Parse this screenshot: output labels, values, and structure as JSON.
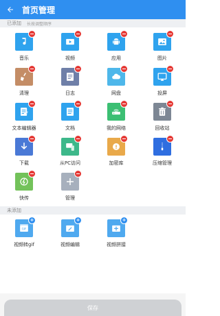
{
  "app_bar": {
    "title": "首页管理"
  },
  "added_section": {
    "label": "已添加",
    "hint": "长按调整顺序"
  },
  "added_tiles": [
    {
      "label": "音乐",
      "color": "#2fa3ee",
      "icon": "music-icon"
    },
    {
      "label": "视频",
      "color": "#2fa3ee",
      "icon": "video-icon"
    },
    {
      "label": "应用",
      "color": "#2fa3ee",
      "icon": "android-icon"
    },
    {
      "label": "图片",
      "color": "#2fa3ee",
      "icon": "image-icon"
    },
    {
      "label": "清理",
      "color": "#c48d66",
      "icon": "broom-icon"
    },
    {
      "label": "日志",
      "color": "#6f7fa8",
      "icon": "log-icon"
    },
    {
      "label": "网盘",
      "color": "#4eb7ea",
      "icon": "cloud-icon"
    },
    {
      "label": "投屏",
      "color": "#2fa3ee",
      "icon": "cast-icon"
    },
    {
      "label": "文本编辑器",
      "color": "#2fa3ee",
      "icon": "text-editor-icon"
    },
    {
      "label": "文档",
      "color": "#2fa3ee",
      "icon": "document-icon"
    },
    {
      "label": "我的网络",
      "color": "#3cbf73",
      "icon": "router-icon"
    },
    {
      "label": "回收站",
      "color": "#7d8794",
      "icon": "trash-icon"
    },
    {
      "label": "下载",
      "color": "#4a79d6",
      "icon": "download-icon"
    },
    {
      "label": "从PC访问",
      "color": "#3db88a",
      "icon": "pc-access-icon"
    },
    {
      "label": "加密库",
      "color": "#e9a94a",
      "icon": "safe-icon"
    },
    {
      "label": "压缩管理",
      "color": "#2f6ee0",
      "icon": "zip-icon"
    },
    {
      "label": "快传",
      "color": "#73c25a",
      "icon": "quick-transfer-icon"
    },
    {
      "label": "管理",
      "color": "#a7b0bd",
      "icon": "plus-manage-icon"
    }
  ],
  "not_added_section": {
    "label": "未添加"
  },
  "not_added_tiles": [
    {
      "label": "视频转gif",
      "color": "#4fa9ef",
      "icon": "video-to-gif-icon"
    },
    {
      "label": "视频编辑",
      "color": "#4fa9ef",
      "icon": "video-edit-icon"
    },
    {
      "label": "视频拼接",
      "color": "#4fa9ef",
      "icon": "video-merge-icon"
    }
  ],
  "footer": {
    "save_label": "保存"
  }
}
